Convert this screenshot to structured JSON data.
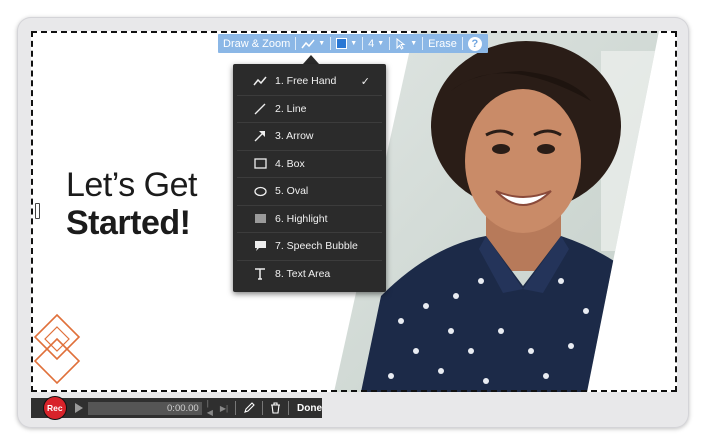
{
  "slide": {
    "headline_line1": "Let’s Get",
    "headline_line2": "Started!"
  },
  "toolbar": {
    "draw_zoom_label": "Draw & Zoom",
    "stroke_width": "4",
    "erase_label": "Erase",
    "help_label": "?",
    "selected_color": "#2a78d4"
  },
  "tool_menu": {
    "items": [
      {
        "label": "1. Free Hand",
        "icon": "freehand-icon",
        "selected": true
      },
      {
        "label": "2. Line",
        "icon": "line-icon"
      },
      {
        "label": "3. Arrow",
        "icon": "arrow-icon"
      },
      {
        "label": "4. Box",
        "icon": "box-icon"
      },
      {
        "label": "5. Oval",
        "icon": "oval-icon"
      },
      {
        "label": "6. Highlight",
        "icon": "highlight-icon"
      },
      {
        "label": "7. Speech Bubble",
        "icon": "speech-bubble-icon"
      },
      {
        "label": "8. Text Area",
        "icon": "text-area-icon"
      }
    ],
    "check_mark": "✓"
  },
  "recorder": {
    "rec_label": "Rec",
    "time": "0:00.00",
    "done_label": "Done"
  },
  "colors": {
    "toolbar_bg": "#8bb7e6",
    "menu_bg": "#2b2b2b",
    "rec_red": "#d8232a",
    "accent_orange": "#e0703a"
  }
}
